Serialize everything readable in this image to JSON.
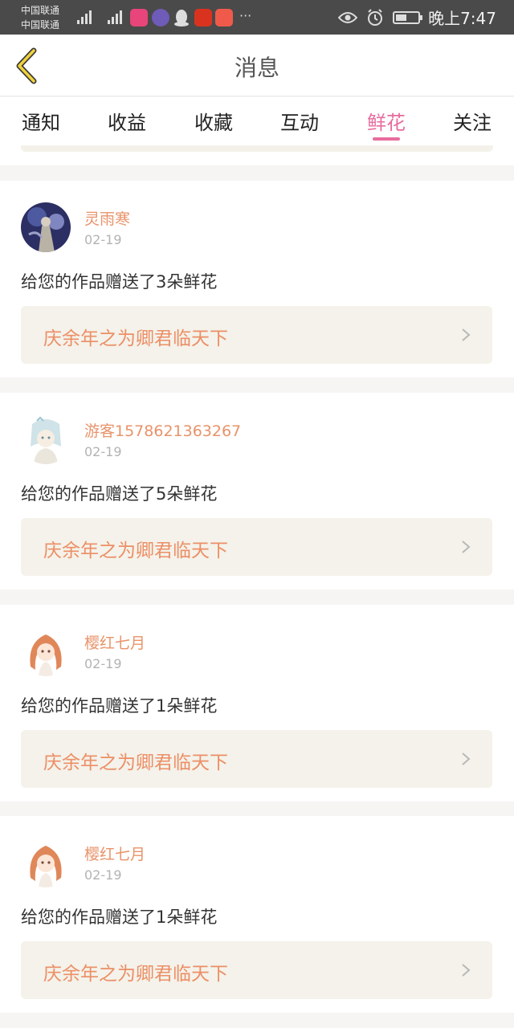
{
  "status_bar": {
    "carrier1": "中国联通",
    "carrier2": "中国联通",
    "net1": "3G",
    "net2": "4G",
    "time": "晚上7:47",
    "battery_level": 0.5
  },
  "header": {
    "title": "消息"
  },
  "tabs": [
    {
      "label": "通知"
    },
    {
      "label": "收益"
    },
    {
      "label": "收藏"
    },
    {
      "label": "互动"
    },
    {
      "label": "鲜花"
    },
    {
      "label": "关注"
    }
  ],
  "active_tab": "鲜花",
  "messages": [
    {
      "user": "灵雨寒",
      "date": "02-19",
      "text": "给您的作品赠送了3朵鲜花",
      "book": "庆余年之为卿君临天下"
    },
    {
      "user": "游客1578621363267",
      "date": "02-19",
      "text": "给您的作品赠送了5朵鲜花",
      "book": "庆余年之为卿君临天下"
    },
    {
      "user": "樱红七月",
      "date": "02-19",
      "text": "给您的作品赠送了1朵鲜花",
      "book": "庆余年之为卿君临天下"
    },
    {
      "user": "樱红七月",
      "date": "02-19",
      "text": "给您的作品赠送了1朵鲜花",
      "book": "庆余年之为卿君临天下"
    }
  ],
  "colors": {
    "accent": "#e86c9e",
    "username": "#e8936a",
    "book_title": "#ec8f66",
    "book_bg": "#f4f2ea"
  }
}
